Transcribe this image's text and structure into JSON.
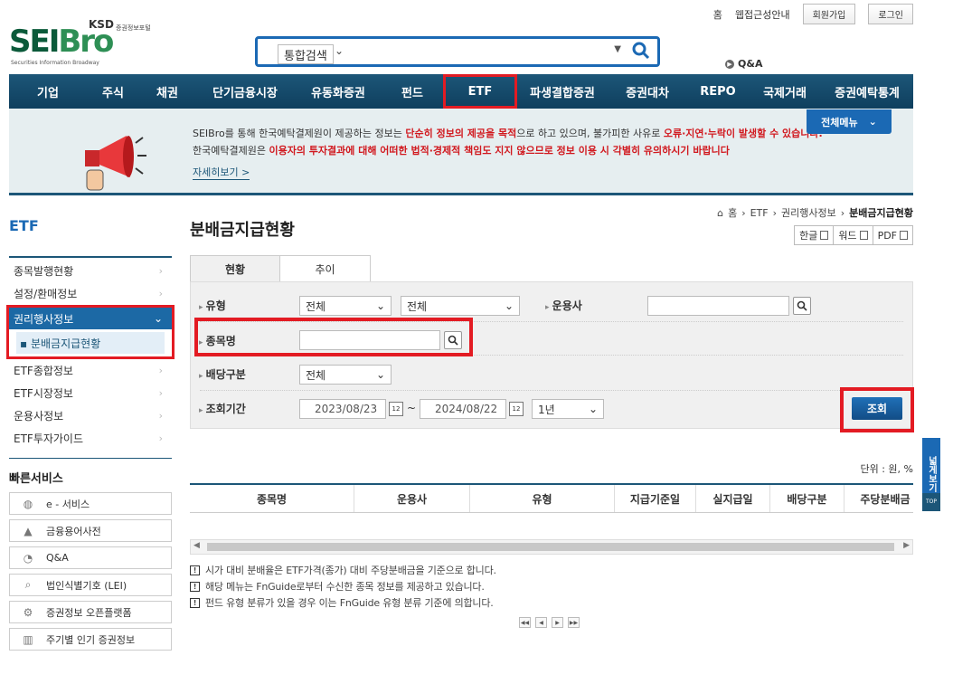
{
  "util": {
    "home": "홈",
    "accessibility": "웹접근성안내",
    "join": "회원가입",
    "login": "로그인"
  },
  "logo": {
    "brand_a": "SEI",
    "brand_b": "Bro",
    "ksd": "KSD",
    "sub": "증권정보포털",
    "eng": "Securities Information Broadway"
  },
  "search": {
    "scope": "통합검색",
    "placeholder": ""
  },
  "qna_top": "Q&A",
  "gnb": [
    "기업",
    "주식",
    "채권",
    "단기금융시장",
    "유동화증권",
    "펀드",
    "ETF",
    "파생결합증권",
    "증권대차",
    "REPO",
    "국제거래",
    "증권예탁통계"
  ],
  "banner": {
    "line1_a": "SEIBro를 통해 한국예탁결제원이 제공하는 정보는 ",
    "line1_red1": "단순히 정보의 제공을 목적",
    "line1_b": "으로 하고 있으며, 불가피한 사유로 ",
    "line1_red2": "오류·지연·누락이 발생할 수 있습니다.",
    "line2_a": "한국예탁결제원은 ",
    "line2_red": "이용자의 투자결과에 대해 어떠한 법적·경제적 책임도 지지 않으므로 정보 이용 시 각별히 유의하시기 바랍니다",
    "more": "자세히보기 >",
    "allmenu": "전체메뉴"
  },
  "lnb": {
    "title": "ETF",
    "items_top": [
      "종목발행현황",
      "설정/환매정보"
    ],
    "group_head": "권리행사정보",
    "group_sub": "▪ 분배금지급현황",
    "items_bottom": [
      "ETF종합정보",
      "ETF시장정보",
      "운용사정보",
      "ETF투자가이드"
    ]
  },
  "quick": {
    "title": "빠른서비스",
    "items": [
      "e - 서비스",
      "금융용어사전",
      "Q&A",
      "법인식별기호 (LEI)",
      "증권정보 오픈플랫폼",
      "주기별 인기 증권정보"
    ]
  },
  "breadcrumb": {
    "home": "홈",
    "c1": "ETF",
    "c2": "권리행사정보",
    "current": "분배금지급현황"
  },
  "page_title": "분배금지급현황",
  "tools": [
    "한글",
    "워드",
    "PDF"
  ],
  "tabs": [
    "현황",
    "추이"
  ],
  "form": {
    "type_label": "유형",
    "type_sel1": "전체",
    "type_sel2": "전체",
    "manager_label": "운용사",
    "name_label": "종목명",
    "dividend_label": "배당구분",
    "dividend_sel": "전체",
    "period_label": "조회기간",
    "date_from": "2023/08/23",
    "tilde": "~",
    "date_to": "2024/08/22",
    "period_sel": "1년",
    "submit": "조회"
  },
  "unit": "단위 :  원, %",
  "table_headers": [
    "종목명",
    "운용사",
    "유형",
    "지급기준일",
    "실지급일",
    "배당구분",
    "주당분배금"
  ],
  "notes": [
    "시가 대비 분배율은 ETF가격(종가) 대비 주당분배금을 기준으로 합니다.",
    "해당 메뉴는 FnGuide로부터 수신한 종목 정보를 제공하고 있습니다.",
    "펀드 유형 분류가 있을 경우 이는 FnGuide 유형 분류 기준에 의합니다."
  ],
  "side_float": "넓게보기",
  "top_btn": "TOP",
  "colors": {
    "primary": "#1b69b4",
    "nav": "#1c5678",
    "highlight": "#e31b23",
    "warn": "#d1191f"
  }
}
